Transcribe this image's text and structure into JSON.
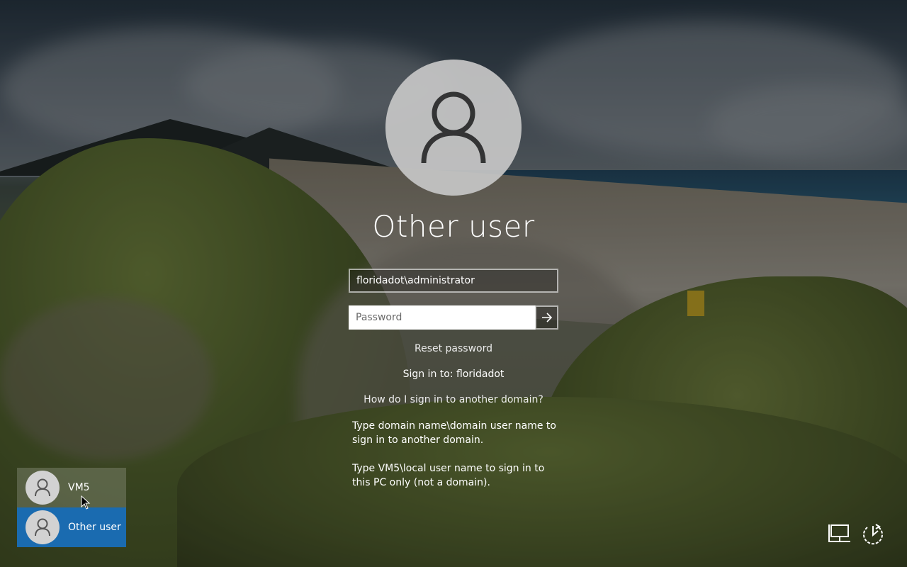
{
  "login": {
    "username_title": "Other user",
    "username_value": "floridadot\\administrator",
    "password_placeholder": "Password",
    "reset_password_label": "Reset password",
    "sign_in_to_label": "Sign in to: floridadot",
    "other_domain_link": "How do I sign in to another domain?",
    "hint_domain": "Type domain name\\domain user name to sign in to another domain.",
    "hint_local": "Type VM5\\local user name to sign in to this PC only (not a domain).",
    "submit_icon": "arrow-right-icon"
  },
  "users": [
    {
      "label": "VM5",
      "icon": "user-icon",
      "selected": false
    },
    {
      "label": "Other user",
      "icon": "user-icon",
      "selected": true
    }
  ],
  "system_icons": [
    "network-icon",
    "ease-of-access-icon"
  ],
  "colors": {
    "selected_tile": "#1a6bb0",
    "text": "#ffffff"
  }
}
